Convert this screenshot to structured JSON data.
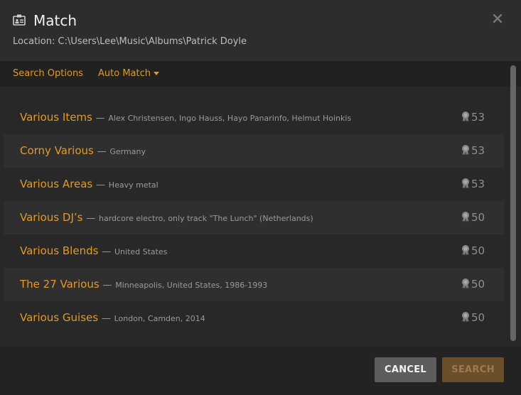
{
  "dialog": {
    "title": "Match",
    "location": "Location: C:\\Users\\Lee\\Music\\Albums\\Patrick Doyle",
    "icons": {
      "title": "id-card-icon",
      "close": "close-icon",
      "score": "award-ribbon-icon",
      "caret": "caret-down-icon"
    }
  },
  "toolbar": {
    "search_options": "Search Options",
    "auto_match": "Auto Match"
  },
  "results": [
    {
      "name": "Various Items",
      "separator": "—",
      "desc": "Alex Christensen, Ingo Hauss, Hayo Panarinfo, Helmut Hoinkis",
      "score": "53"
    },
    {
      "name": "Corny Various",
      "separator": "—",
      "desc": "Germany",
      "score": "53"
    },
    {
      "name": "Various Areas",
      "separator": "—",
      "desc": "Heavy metal",
      "score": "53"
    },
    {
      "name": "Various DJ’s",
      "separator": "—",
      "desc": "hardcore electro, only track \"The Lunch\" (Netherlands)",
      "score": "50"
    },
    {
      "name": "Various Blends",
      "separator": "—",
      "desc": "United States",
      "score": "50"
    },
    {
      "name": "The 27 Various",
      "separator": "—",
      "desc": "Minneapolis, United States, 1986-1993",
      "score": "50"
    },
    {
      "name": "Various Guises",
      "separator": "—",
      "desc": "London, Camden, 2014",
      "score": "50"
    }
  ],
  "footer": {
    "cancel": "CANCEL",
    "search": "SEARCH"
  },
  "colors": {
    "accent": "#e09a2b",
    "background": "#282828",
    "muted": "#9a9a9a"
  }
}
